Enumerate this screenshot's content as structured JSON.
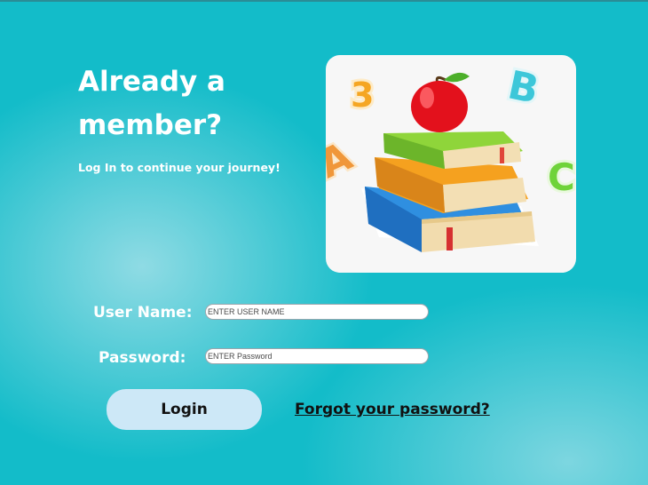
{
  "intro": {
    "heading": "Already a member?",
    "subheading": "Log In to continue your journey!"
  },
  "illustration": {
    "alt": "books-with-apple-and-letters",
    "number": "3",
    "letter_b": "B",
    "letter_c": "C",
    "letter_a": "A"
  },
  "form": {
    "username_label": "User Name:",
    "username_placeholder": "ENTER USER NAME",
    "password_label": "Password:",
    "password_placeholder": "ENTER Password",
    "login_label": "Login",
    "forgot_label": "Forgot your password?"
  },
  "colors": {
    "background": "#13bcc9",
    "button": "#cde8f7",
    "text_light": "#ffffff",
    "text_dark": "#111111"
  }
}
